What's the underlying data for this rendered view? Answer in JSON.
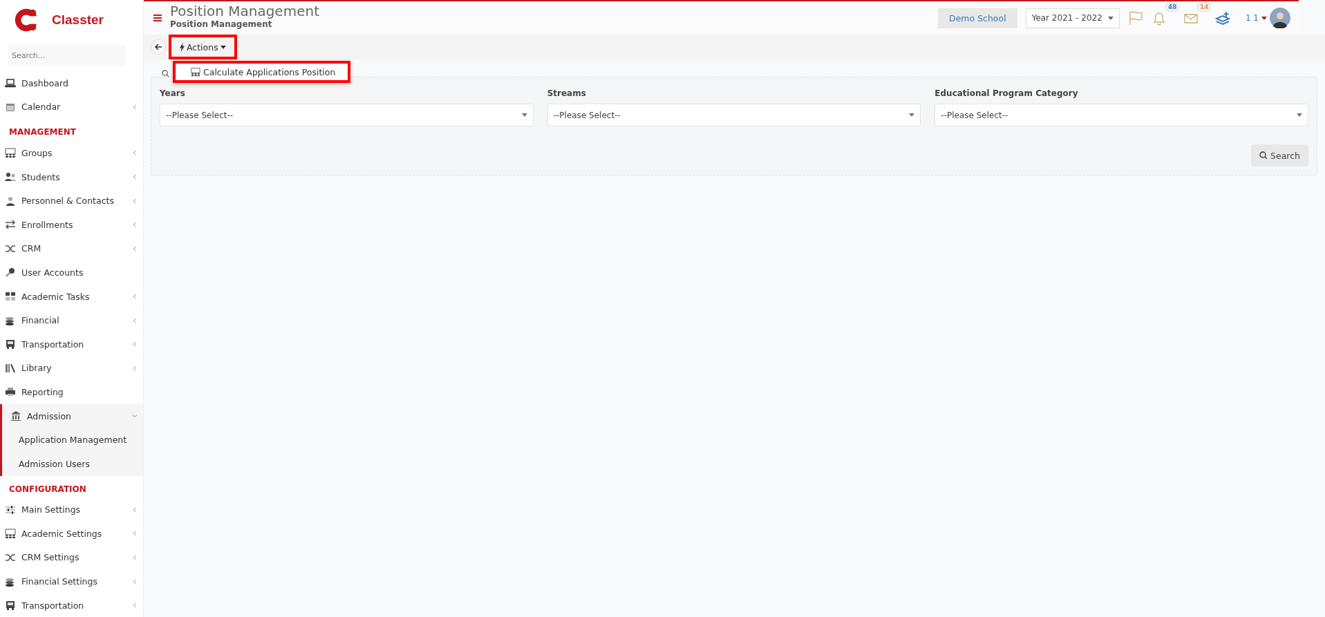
{
  "sidebar": {
    "brand": "Classter",
    "search": {
      "placeholder": "Search..."
    },
    "sections": [
      {
        "items": [
          {
            "label": "Dashboard",
            "selected": false
          },
          {
            "label": "Calendar",
            "expanded": false,
            "selected": false
          }
        ]
      },
      {
        "heading": "MANAGEMENT",
        "items": [
          {
            "label": "Groups",
            "expanded": false,
            "selected": false
          },
          {
            "label": "Students",
            "expanded": false,
            "selected": false
          },
          {
            "label": "Personnel & Contacts",
            "expanded": false,
            "selected": false
          },
          {
            "label": "Enrollments",
            "expanded": false,
            "selected": false
          },
          {
            "label": "CRM",
            "expanded": false,
            "selected": false
          },
          {
            "label": "User Accounts",
            "selected": false
          },
          {
            "label": "Academic Tasks",
            "expanded": false,
            "selected": false
          },
          {
            "label": "Financial",
            "expanded": false,
            "selected": false
          },
          {
            "label": "Transportation",
            "expanded": false,
            "selected": false
          },
          {
            "label": "Library",
            "expanded": false,
            "selected": false
          },
          {
            "label": "Reporting",
            "selected": false
          },
          {
            "label": "Admission",
            "expanded": true,
            "selected": true,
            "children": [
              {
                "label": "Application Management"
              },
              {
                "label": "Admission Users"
              }
            ]
          }
        ]
      },
      {
        "heading": "CONFIGURATION",
        "items": [
          {
            "label": "Main Settings",
            "expanded": false,
            "selected": false
          },
          {
            "label": "Academic Settings",
            "expanded": false,
            "selected": false
          },
          {
            "label": "CRM Settings",
            "expanded": false,
            "selected": false
          },
          {
            "label": "Financial Settings",
            "expanded": false,
            "selected": false
          },
          {
            "label": "Transportation",
            "expanded": false,
            "selected": false
          }
        ]
      }
    ]
  },
  "header": {
    "title": "Position Management",
    "subtitle": "Position Management",
    "school": "Demo School",
    "year": "Year 2021 - 2022",
    "notifications": "48",
    "messages": "14",
    "user": "1 1"
  },
  "toolbar": {
    "actions": {
      "label": "Actions",
      "highlighted": true,
      "expanded": true
    },
    "menu": [
      {
        "label": "Calculate Applications Position",
        "highlighted": true
      }
    ]
  },
  "filters": [
    {
      "label": "Years",
      "placeholder": "--Please Select--"
    },
    {
      "label": "Streams",
      "placeholder": "--Please Select--"
    },
    {
      "label": "Educational Program Category",
      "placeholder": "--Please Select--"
    }
  ],
  "search_button": "Search"
}
